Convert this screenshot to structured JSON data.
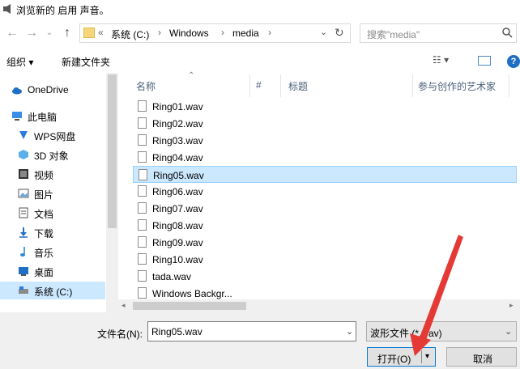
{
  "window": {
    "title": "浏览新的 启用 声音。"
  },
  "address": {
    "chevrons": "«",
    "crumbs": [
      "系统 (C:)",
      "Windows",
      "media"
    ],
    "separator": "›"
  },
  "search": {
    "placeholder": "搜索\"media\""
  },
  "toolbar": {
    "organize": "组织 ▾",
    "new_folder": "新建文件夹",
    "views": "☷ ▾",
    "help": "?"
  },
  "nav": {
    "items": [
      {
        "label": "OneDrive",
        "icon": "onedrive-icon"
      },
      {
        "label": "此电脑",
        "icon": "computer-icon"
      },
      {
        "label": "WPS网盘",
        "icon": "cloud-drive-icon"
      },
      {
        "label": "3D 对象",
        "icon": "3d-objects-icon"
      },
      {
        "label": "视频",
        "icon": "video-icon"
      },
      {
        "label": "图片",
        "icon": "pictures-icon"
      },
      {
        "label": "文档",
        "icon": "documents-icon"
      },
      {
        "label": "下载",
        "icon": "download-icon"
      },
      {
        "label": "音乐",
        "icon": "music-icon"
      },
      {
        "label": "桌面",
        "icon": "desktop-icon"
      },
      {
        "label": "系统 (C:)",
        "icon": "drive-icon"
      }
    ]
  },
  "columns": {
    "name": "名称",
    "number": "#",
    "title": "标题",
    "artist": "参与创作的艺术家"
  },
  "files": [
    "Ring01.wav",
    "Ring02.wav",
    "Ring03.wav",
    "Ring04.wav",
    "Ring05.wav",
    "Ring06.wav",
    "Ring07.wav",
    "Ring08.wav",
    "Ring09.wav",
    "Ring10.wav",
    "tada.wav",
    "Windows Backgr..."
  ],
  "selected_file": "Ring05.wav",
  "footer": {
    "filename_label": "文件名(N):",
    "filename_value": "Ring05.wav",
    "filetype_value": "波形文件 (*.wav)",
    "open_label": "打开(O)",
    "cancel_label": "取消"
  },
  "colors": {
    "selection": "#cce8ff",
    "accent": "#0078d7",
    "arrow": "#e53935"
  }
}
